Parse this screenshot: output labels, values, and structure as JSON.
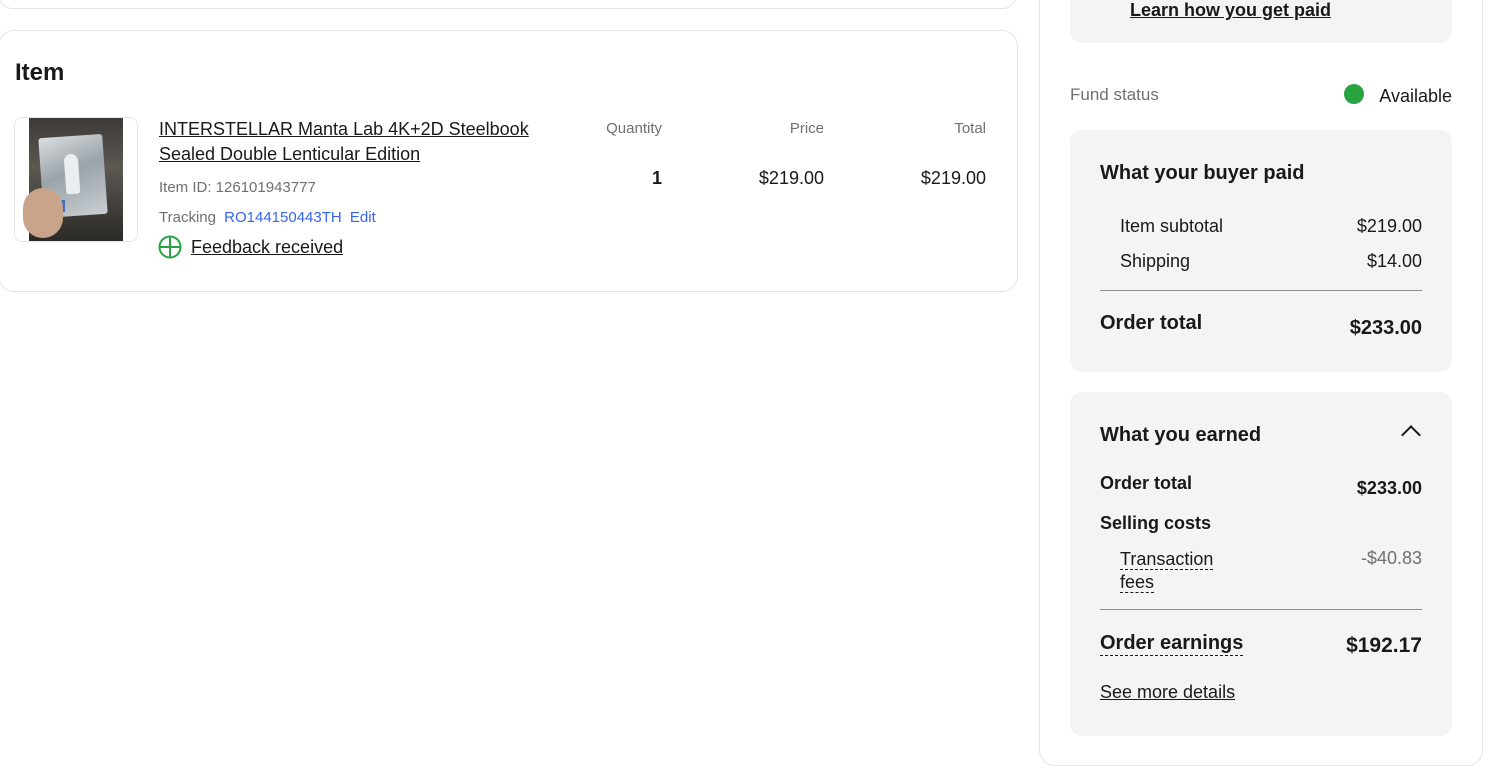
{
  "item_card": {
    "heading": "Item",
    "title": "INTERSTELLAR Manta Lab 4K+2D Steelbook Sealed Double Lenticular Edition",
    "item_id": "Item ID: 126101943777",
    "tracking_label": "Tracking",
    "tracking_number": "RO144150443TH",
    "edit_label": "Edit",
    "feedback_text": "Feedback received",
    "columns": {
      "quantity": "Quantity",
      "price": "Price",
      "total": "Total"
    },
    "values": {
      "quantity": "1",
      "price": "$219.00",
      "total": "$219.00"
    }
  },
  "right_panel": {
    "learn_link": "Learn how you get paid",
    "fund_status_label": "Fund status",
    "fund_status_value": "Available",
    "fund_status_color": "#27a33f",
    "buyer_paid": {
      "title": "What your buyer paid",
      "item_subtotal_label": "Item subtotal",
      "item_subtotal_value": "$219.00",
      "shipping_label": "Shipping",
      "shipping_value": "$14.00",
      "order_total_label": "Order total",
      "order_total_value": "$233.00"
    },
    "earned": {
      "title": "What you earned",
      "order_total_label": "Order total",
      "order_total_value": "$233.00",
      "selling_costs_label": "Selling costs",
      "transaction_label_line1": "Transaction",
      "transaction_label_line2": "fees",
      "transaction_value": "-$40.83",
      "order_earnings_label": "Order earnings",
      "order_earnings_value": "$192.17",
      "see_more": "See more details"
    }
  }
}
